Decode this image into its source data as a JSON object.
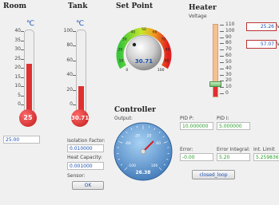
{
  "room": {
    "title": "Room",
    "unit": "℃",
    "scale": [
      "40",
      "35",
      "30",
      "25",
      "20",
      "15",
      "10",
      "5",
      "0"
    ],
    "value_display": "25",
    "setpoint_field": "25.00",
    "level": 25,
    "max": 40
  },
  "tank": {
    "title": "Tank",
    "unit": "℃",
    "scale": [
      "100",
      "80",
      "60",
      "40",
      "20",
      "0"
    ],
    "value_display": "30.71",
    "level": 30.71,
    "max": 100,
    "isolation_label": "Isolation Factor:",
    "isolation_value": "0.010000",
    "heat_capacity_label": "Heat Capacity:",
    "heat_capacity_value": "0.001000",
    "sensor_label": "Sensor:",
    "ok_label": "OK"
  },
  "setpoint": {
    "title": "Set Point",
    "ticks": [
      "0",
      "10",
      "20",
      "30",
      "40",
      "50",
      "60",
      "70",
      "80",
      "90",
      "100"
    ],
    "value": "30.71"
  },
  "heater": {
    "title": "Heater",
    "voltage_label": "Voltage",
    "scale": [
      "110",
      "100",
      "90",
      "80",
      "70",
      "60",
      "50",
      "40",
      "30",
      "20",
      "10",
      "0"
    ],
    "box1": "25.26",
    "box2": "57.07",
    "unit_suffix": "V",
    "level": 20
  },
  "controller": {
    "title": "Controller",
    "output_label": "Output:",
    "gauge_ticks": [
      "-60",
      "-20",
      "20",
      "60",
      "-100",
      "100"
    ],
    "gauge_value": "26.38",
    "pid_p_label": "PID P:",
    "pid_p_value": "10.000000",
    "pid_i_label": "PID I:",
    "pid_i_value": "5.000000",
    "error_label": "Error:",
    "error_value": "-0.00",
    "error_integral_label": "Error Integral:",
    "error_integral_value": "5.20",
    "int_limit_label": "Int. Limit",
    "int_limit_value": "5.259836",
    "closed_loop_label": "closed_loop"
  }
}
